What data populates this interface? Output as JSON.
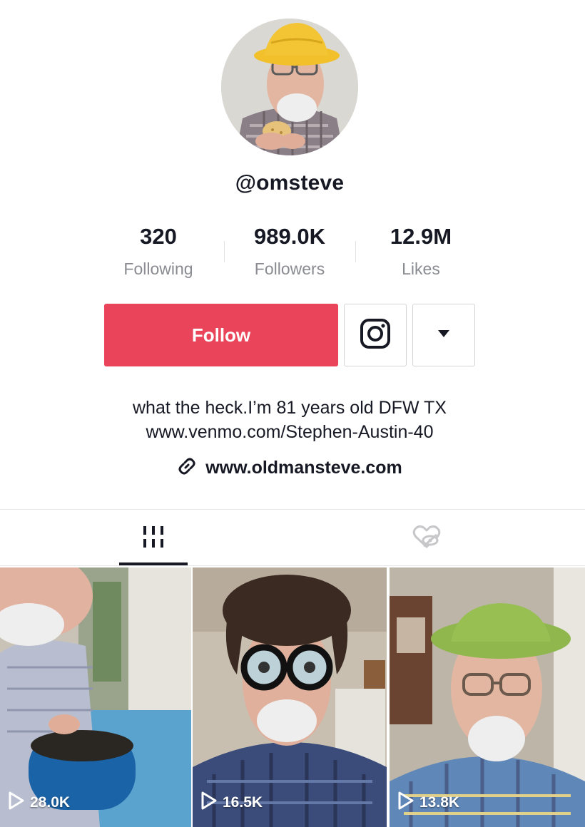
{
  "profile": {
    "username": "@omsteve",
    "stats": [
      {
        "value": "320",
        "label": "Following"
      },
      {
        "value": "989.0K",
        "label": "Followers"
      },
      {
        "value": "12.9M",
        "label": "Likes"
      }
    ],
    "bio_line1": "what the heck.I’m 81 years old  DFW TX",
    "bio_line2": "www.venmo.com/Stephen-Austin-40",
    "link": "www.oldmansteve.com"
  },
  "actions": {
    "follow_label": "Follow",
    "instagram_icon": "instagram-icon",
    "more_icon": "caret-down-icon"
  },
  "tabs": [
    {
      "icon": "videos-grid-icon",
      "active": true
    },
    {
      "icon": "liked-hidden-icon",
      "active": false
    }
  ],
  "videos": [
    {
      "views": "28.0K"
    },
    {
      "views": "16.5K"
    },
    {
      "views": "13.8K"
    }
  ],
  "colors": {
    "follow": "#ea445a",
    "text": "#161823",
    "muted": "#8a8b91"
  }
}
